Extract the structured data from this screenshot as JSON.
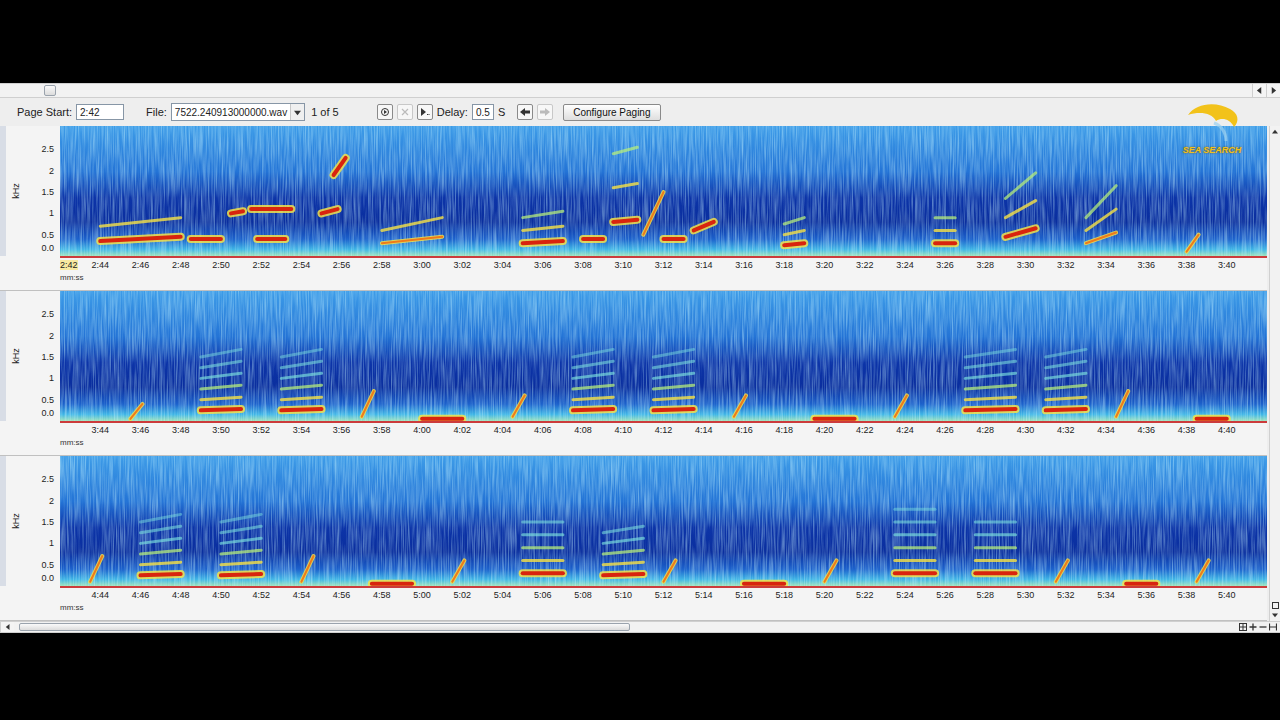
{
  "toolbar": {
    "page_start_label": "Page Start:",
    "page_start": "2:42",
    "file_label": "File:",
    "file": "7522.240913000000.wav",
    "page_count": "1 of 5",
    "delay_label": "Delay:",
    "delay": "0.5",
    "delay_unit": "S",
    "configure_button": "Configure Paging"
  },
  "logo": {
    "text": "SEA SEARCH"
  },
  "scrollbars": {
    "page": {
      "position": 0.035,
      "level": 0.01
    },
    "time": {
      "position": 0.004,
      "level": 0.5
    }
  },
  "spectrogram": {
    "y_label": "kHz",
    "x_label": "mm:ss",
    "y_ticks": [
      "2.5",
      "2",
      "1.5",
      "1",
      "0.5",
      "0.0"
    ],
    "f_max": 3.05,
    "panels": [
      {
        "start": 162,
        "duration": 60,
        "ticks": [
          "2:42",
          "2:44",
          "2:46",
          "2:48",
          "2:50",
          "2:52",
          "2:54",
          "2:56",
          "2:58",
          "3:00",
          "3:02",
          "3:04",
          "3:06",
          "3:08",
          "3:10",
          "3:12",
          "3:14",
          "3:16",
          "3:18",
          "3:20",
          "3:22",
          "3:24",
          "3:26",
          "3:28",
          "3:30",
          "3:32",
          "3:34",
          "3:36",
          "3:38",
          "3:40"
        ],
        "calls": [
          {
            "t": 164,
            "d": 4,
            "f0": 0.35,
            "f1": 0.45,
            "h": 2
          },
          {
            "t": 168.5,
            "d": 1.5,
            "f0": 0.4,
            "f1": 0.4,
            "h": 1
          },
          {
            "t": 170.5,
            "d": 0.6,
            "f0": 1.0,
            "f1": 1.05,
            "h": 1
          },
          {
            "t": 171.5,
            "d": 2,
            "f0": 1.1,
            "f1": 1.1,
            "h": 1
          },
          {
            "t": 171.8,
            "d": 1.4,
            "f0": 0.4,
            "f1": 0.4,
            "h": 1
          },
          {
            "t": 175,
            "d": 0.8,
            "f0": 1.0,
            "f1": 1.1,
            "h": 1
          },
          {
            "t": 175.6,
            "d": 0.6,
            "f0": 1.9,
            "f1": 2.3,
            "h": 1
          },
          {
            "t": 178,
            "d": 3,
            "f0": 0.3,
            "f1": 0.45,
            "h": 2
          },
          {
            "t": 185,
            "d": 2,
            "f0": 0.3,
            "f1": 0.35,
            "h": 3
          },
          {
            "t": 188,
            "d": 1,
            "f0": 0.4,
            "f1": 0.4,
            "h": 1
          },
          {
            "t": 189.5,
            "d": 1.2,
            "f0": 0.8,
            "f1": 0.85,
            "h": 3
          },
          {
            "t": 191,
            "d": 1,
            "f0": 0.5,
            "f1": 1.5,
            "h": 1
          },
          {
            "t": 192,
            "d": 1,
            "f0": 0.4,
            "f1": 0.4,
            "h": 1
          },
          {
            "t": 193.5,
            "d": 1,
            "f0": 0.6,
            "f1": 0.8,
            "h": 1
          },
          {
            "t": 198,
            "d": 1,
            "f0": 0.25,
            "f1": 0.3,
            "h": 3
          },
          {
            "t": 205.5,
            "d": 1,
            "f0": 0.3,
            "f1": 0.3,
            "h": 3
          },
          {
            "t": 209,
            "d": 1.5,
            "f0": 0.45,
            "f1": 0.65,
            "h": 3
          },
          {
            "t": 213,
            "d": 1.5,
            "f0": 0.3,
            "f1": 0.55,
            "h": 3
          },
          {
            "t": 218,
            "d": 0.6,
            "f0": 0.1,
            "f1": 0.5,
            "h": 1
          }
        ]
      },
      {
        "start": 222,
        "duration": 60,
        "ticks": [
          "3:44",
          "3:46",
          "3:48",
          "3:50",
          "3:52",
          "3:54",
          "3:56",
          "3:58",
          "4:00",
          "4:02",
          "4:04",
          "4:06",
          "4:08",
          "4:10",
          "4:12",
          "4:14",
          "4:16",
          "4:18",
          "4:20",
          "4:22",
          "4:24",
          "4:26",
          "4:28",
          "4:30",
          "4:32",
          "4:34",
          "4:36",
          "4:38",
          "4:40"
        ],
        "calls": [
          {
            "t": 225.5,
            "d": 0.6,
            "f0": 0.05,
            "f1": 0.4,
            "h": 1
          },
          {
            "t": 229,
            "d": 2,
            "f0": 0.25,
            "f1": 0.28,
            "h": 6
          },
          {
            "t": 233,
            "d": 2,
            "f0": 0.25,
            "f1": 0.28,
            "h": 6
          },
          {
            "t": 237,
            "d": 0.6,
            "f0": 0.1,
            "f1": 0.7,
            "h": 1
          },
          {
            "t": 240,
            "d": 2,
            "f0": 0.05,
            "f1": 0.05,
            "h": 1
          },
          {
            "t": 244.5,
            "d": 0.6,
            "f0": 0.1,
            "f1": 0.6,
            "h": 1
          },
          {
            "t": 247.5,
            "d": 2,
            "f0": 0.25,
            "f1": 0.28,
            "h": 6
          },
          {
            "t": 251.5,
            "d": 2,
            "f0": 0.25,
            "f1": 0.28,
            "h": 6
          },
          {
            "t": 255.5,
            "d": 0.6,
            "f0": 0.1,
            "f1": 0.6,
            "h": 1
          },
          {
            "t": 259.5,
            "d": 2,
            "f0": 0.05,
            "f1": 0.05,
            "h": 1
          },
          {
            "t": 263.5,
            "d": 0.6,
            "f0": 0.1,
            "f1": 0.6,
            "h": 1
          },
          {
            "t": 267,
            "d": 2.5,
            "f0": 0.25,
            "f1": 0.28,
            "h": 6
          },
          {
            "t": 271,
            "d": 2,
            "f0": 0.25,
            "f1": 0.28,
            "h": 6
          },
          {
            "t": 274.5,
            "d": 0.6,
            "f0": 0.1,
            "f1": 0.7,
            "h": 1
          },
          {
            "t": 278.5,
            "d": 1.5,
            "f0": 0.05,
            "f1": 0.05,
            "h": 1
          }
        ]
      },
      {
        "start": 282,
        "duration": 60,
        "ticks": [
          "4:44",
          "4:46",
          "4:48",
          "4:50",
          "4:52",
          "4:54",
          "4:56",
          "4:58",
          "5:00",
          "5:02",
          "5:04",
          "5:06",
          "5:08",
          "5:10",
          "5:12",
          "5:14",
          "5:16",
          "5:18",
          "5:20",
          "5:22",
          "5:24",
          "5:26",
          "5:28",
          "5:30",
          "5:32",
          "5:34",
          "5:36",
          "5:38",
          "5:40"
        ],
        "calls": [
          {
            "t": 283.5,
            "d": 0.6,
            "f0": 0.1,
            "f1": 0.7,
            "h": 1
          },
          {
            "t": 286,
            "d": 2,
            "f0": 0.25,
            "f1": 0.28,
            "h": 6
          },
          {
            "t": 290,
            "d": 2,
            "f0": 0.25,
            "f1": 0.28,
            "h": 6
          },
          {
            "t": 294,
            "d": 0.6,
            "f0": 0.1,
            "f1": 0.7,
            "h": 1
          },
          {
            "t": 297.5,
            "d": 2,
            "f0": 0.05,
            "f1": 0.05,
            "h": 1
          },
          {
            "t": 301.5,
            "d": 0.6,
            "f0": 0.1,
            "f1": 0.6,
            "h": 1
          },
          {
            "t": 305,
            "d": 2,
            "f0": 0.3,
            "f1": 0.3,
            "h": 5
          },
          {
            "t": 309,
            "d": 2,
            "f0": 0.25,
            "f1": 0.28,
            "h": 5
          },
          {
            "t": 312,
            "d": 0.6,
            "f0": 0.1,
            "f1": 0.6,
            "h": 1
          },
          {
            "t": 316,
            "d": 2,
            "f0": 0.05,
            "f1": 0.05,
            "h": 1
          },
          {
            "t": 320,
            "d": 0.6,
            "f0": 0.1,
            "f1": 0.6,
            "h": 1
          },
          {
            "t": 323.5,
            "d": 2,
            "f0": 0.3,
            "f1": 0.3,
            "h": 6
          },
          {
            "t": 327.5,
            "d": 2,
            "f0": 0.3,
            "f1": 0.3,
            "h": 5
          },
          {
            "t": 331.5,
            "d": 0.6,
            "f0": 0.1,
            "f1": 0.6,
            "h": 1
          },
          {
            "t": 335,
            "d": 1.5,
            "f0": 0.05,
            "f1": 0.05,
            "h": 1
          },
          {
            "t": 338.5,
            "d": 0.6,
            "f0": 0.1,
            "f1": 0.6,
            "h": 1
          }
        ]
      }
    ]
  }
}
